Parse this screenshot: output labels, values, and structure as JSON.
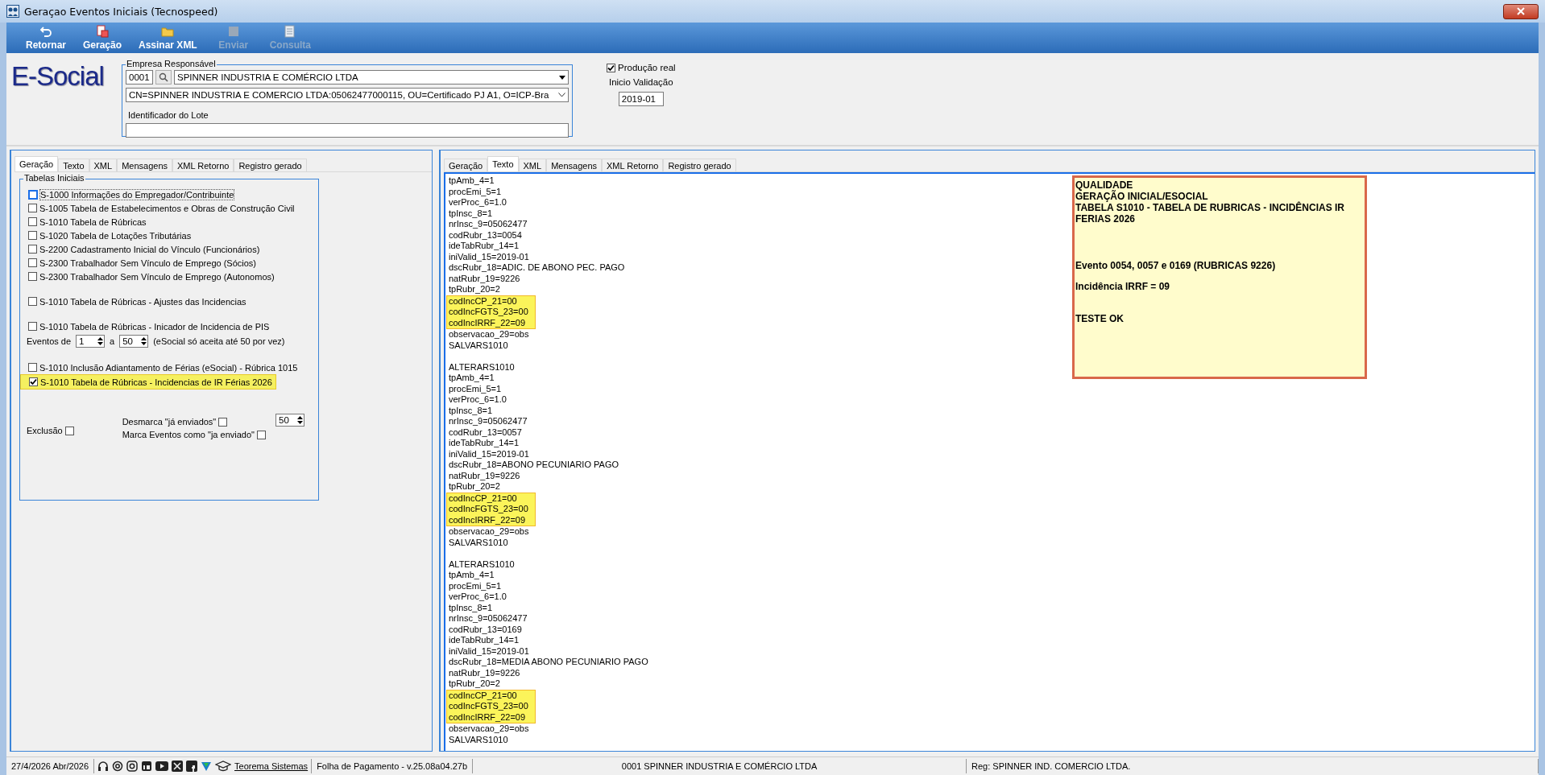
{
  "window": {
    "title": "Geraçao Eventos Iniciais (Tecnospeed)"
  },
  "toolbar": [
    {
      "label": "Retornar",
      "disabled": false
    },
    {
      "label": "Geração",
      "disabled": false
    },
    {
      "label": "Assinar XML",
      "disabled": false
    },
    {
      "label": "Enviar",
      "disabled": true
    },
    {
      "label": "Consulta",
      "disabled": true
    }
  ],
  "logo": "E-Social",
  "empresa": {
    "legend": "Empresa Responsável",
    "code": "0001",
    "company": "SPINNER INDUSTRIA E COMÉRCIO LTDA",
    "certificate": "CN=SPINNER INDUSTRIA E COMERCIO LTDA:05062477000115, OU=Certificado PJ A1, O=ICP-Bra",
    "lote_label": "Identificador do Lote"
  },
  "producao": {
    "label": "Produção real",
    "checked": true
  },
  "validacao": {
    "label": "Inicio Validação",
    "value": "2019-01"
  },
  "left_panel": {
    "tabs": [
      {
        "label": "Geração",
        "selected": true
      },
      {
        "label": "Texto",
        "selected": false
      },
      {
        "label": "XML",
        "selected": false
      },
      {
        "label": "Mensagens",
        "selected": false
      },
      {
        "label": "XML Retorno",
        "selected": false
      },
      {
        "label": "Registro gerado",
        "selected": false
      }
    ],
    "group_title": "Tabelas Iniciais",
    "groups": [
      {
        "items": [
          {
            "label": "S-1000 Informações do Empregador/Contribuinte",
            "checked": false,
            "focused": true,
            "highlighted": false
          },
          {
            "label": "S-1005 Tabela de Estabelecimentos e Obras de Construção Civil",
            "checked": false,
            "focused": false,
            "highlighted": false
          },
          {
            "label": "S-1010 Tabela de Rúbricas",
            "checked": false,
            "focused": false,
            "highlighted": false
          },
          {
            "label": "S-1020 Tabela de Lotações Tributárias",
            "checked": false,
            "focused": false,
            "highlighted": false
          },
          {
            "label": "S-2200 Cadastramento Inicial do Vínculo (Funcionários)",
            "checked": false,
            "focused": false,
            "highlighted": false
          },
          {
            "label": "S-2300 Trabalhador Sem Vínculo de Emprego (Sócios)",
            "checked": false,
            "focused": false,
            "highlighted": false
          },
          {
            "label": "S-2300 Trabalhador Sem Vínculo de Emprego (Autonomos)",
            "checked": false,
            "focused": false,
            "highlighted": false
          }
        ]
      },
      {
        "items": [
          {
            "label": "S-1010 Tabela de Rúbricas - Ajustes das Incidencias",
            "checked": false,
            "focused": false,
            "highlighted": false
          }
        ]
      },
      {
        "items": [
          {
            "label": "S-1010 Tabela de Rúbricas - Inicador de Incidencia de PIS",
            "checked": false,
            "focused": false,
            "highlighted": false
          }
        ],
        "range": {
          "label": "Eventos de",
          "from": "1",
          "separator": "a",
          "to": "50",
          "note": "(eSocial só aceita até 50 por vez)"
        }
      },
      {
        "items": [
          {
            "label": "S-1010 Inclusão Adiantamento de Férias (eSocial) - Rúbrica 1015",
            "checked": false,
            "focused": false,
            "highlighted": false
          },
          {
            "label": "S-1010 Tabela de Rúbricas -  Incidencias  de IR Férias 2026",
            "checked": true,
            "focused": false,
            "highlighted": true
          }
        ]
      }
    ],
    "exclusao": {
      "label": "Exclusão",
      "checked": false
    },
    "desmarca": {
      "label": "Desmarca \"já enviados\"",
      "checked": false
    },
    "marca": {
      "label": "Marca Eventos como \"ja enviado\"",
      "checked": false
    },
    "limit": "50"
  },
  "right_panel": {
    "tabs": [
      {
        "label": "Geração",
        "selected": false
      },
      {
        "label": "Texto",
        "selected": true
      },
      {
        "label": "XML",
        "selected": false
      },
      {
        "label": "Mensagens",
        "selected": false
      },
      {
        "label": "XML Retorno",
        "selected": false
      },
      {
        "label": "Registro gerado",
        "selected": false
      }
    ],
    "blocks": [
      [
        {
          "text": "tpAmb_4=1",
          "highlighted": false
        },
        {
          "text": "procEmi_5=1",
          "highlighted": false
        },
        {
          "text": "verProc_6=1.0",
          "highlighted": false
        },
        {
          "text": "tpInsc_8=1",
          "highlighted": false
        },
        {
          "text": "nrInsc_9=05062477",
          "highlighted": false
        },
        {
          "text": "codRubr_13=0054",
          "highlighted": false
        },
        {
          "text": "ideTabRubr_14=1",
          "highlighted": false
        },
        {
          "text": "iniValid_15=2019-01",
          "highlighted": false
        },
        {
          "text": "dscRubr_18=ADIC. DE ABONO PEC. PAGO",
          "highlighted": false
        },
        {
          "text": "natRubr_19=9226",
          "highlighted": false
        },
        {
          "text": "tpRubr_20=2",
          "highlighted": false
        },
        {
          "text": "codIncCP_21=00",
          "highlighted": true
        },
        {
          "text": "codIncFGTS_23=00",
          "highlighted": true
        },
        {
          "text": "codIncIRRF_22=09",
          "highlighted": true
        },
        {
          "text": "observacao_29=obs",
          "highlighted": false
        },
        {
          "text": "SALVARS1010",
          "highlighted": false
        }
      ],
      [
        {
          "text": "ALTERARS1010",
          "highlighted": false
        },
        {
          "text": "tpAmb_4=1",
          "highlighted": false
        },
        {
          "text": "procEmi_5=1",
          "highlighted": false
        },
        {
          "text": "verProc_6=1.0",
          "highlighted": false
        },
        {
          "text": "tpInsc_8=1",
          "highlighted": false
        },
        {
          "text": "nrInsc_9=05062477",
          "highlighted": false
        },
        {
          "text": "codRubr_13=0057",
          "highlighted": false
        },
        {
          "text": "ideTabRubr_14=1",
          "highlighted": false
        },
        {
          "text": "iniValid_15=2019-01",
          "highlighted": false
        },
        {
          "text": "dscRubr_18=ABONO PECUNIARIO PAGO",
          "highlighted": false
        },
        {
          "text": "natRubr_19=9226",
          "highlighted": false
        },
        {
          "text": "tpRubr_20=2",
          "highlighted": false
        },
        {
          "text": "codIncCP_21=00",
          "highlighted": true
        },
        {
          "text": "codIncFGTS_23=00",
          "highlighted": true
        },
        {
          "text": "codIncIRRF_22=09",
          "highlighted": true
        },
        {
          "text": "observacao_29=obs",
          "highlighted": false
        },
        {
          "text": "SALVARS1010",
          "highlighted": false
        }
      ],
      [
        {
          "text": "ALTERARS1010",
          "highlighted": false
        },
        {
          "text": "tpAmb_4=1",
          "highlighted": false
        },
        {
          "text": "procEmi_5=1",
          "highlighted": false
        },
        {
          "text": "verProc_6=1.0",
          "highlighted": false
        },
        {
          "text": "tpInsc_8=1",
          "highlighted": false
        },
        {
          "text": "nrInsc_9=05062477",
          "highlighted": false
        },
        {
          "text": "codRubr_13=0169",
          "highlighted": false
        },
        {
          "text": "ideTabRubr_14=1",
          "highlighted": false
        },
        {
          "text": "iniValid_15=2019-01",
          "highlighted": false
        },
        {
          "text": "dscRubr_18=MEDIA ABONO PECUNIARIO PAGO",
          "highlighted": false
        },
        {
          "text": "natRubr_19=9226",
          "highlighted": false
        },
        {
          "text": "tpRubr_20=2",
          "highlighted": false
        },
        {
          "text": "codIncCP_21=00",
          "highlighted": true
        },
        {
          "text": "codIncFGTS_23=00",
          "highlighted": true
        },
        {
          "text": "codIncIRRF_22=09",
          "highlighted": true
        },
        {
          "text": "observacao_29=obs",
          "highlighted": false
        },
        {
          "text": "SALVARS1010",
          "highlighted": false
        }
      ]
    ],
    "note": [
      [
        "QUALIDADE",
        "GERAÇÃO INICIAL/ESOCIAL",
        "TABELA S1010 - TABELA DE RUBRICAS - INCIDÊNCIAS IR FERIAS 2026"
      ],
      [
        "Evento 0054, 0057 e 0169 (RUBRICAS 9226)"
      ],
      [
        "Incidência IRRF = 09"
      ],
      [
        "TESTE OK"
      ]
    ]
  },
  "status_bar": {
    "date": "27/4/2026 Abr/2026",
    "link": "Teorema Sistemas",
    "product": "Folha de Pagamento - v.25.08a04.27b",
    "company": "0001 SPINNER INDUSTRIA E COMÉRCIO LTDA",
    "registration": "Reg: SPINNER IND. COMERCIO LTDA."
  }
}
